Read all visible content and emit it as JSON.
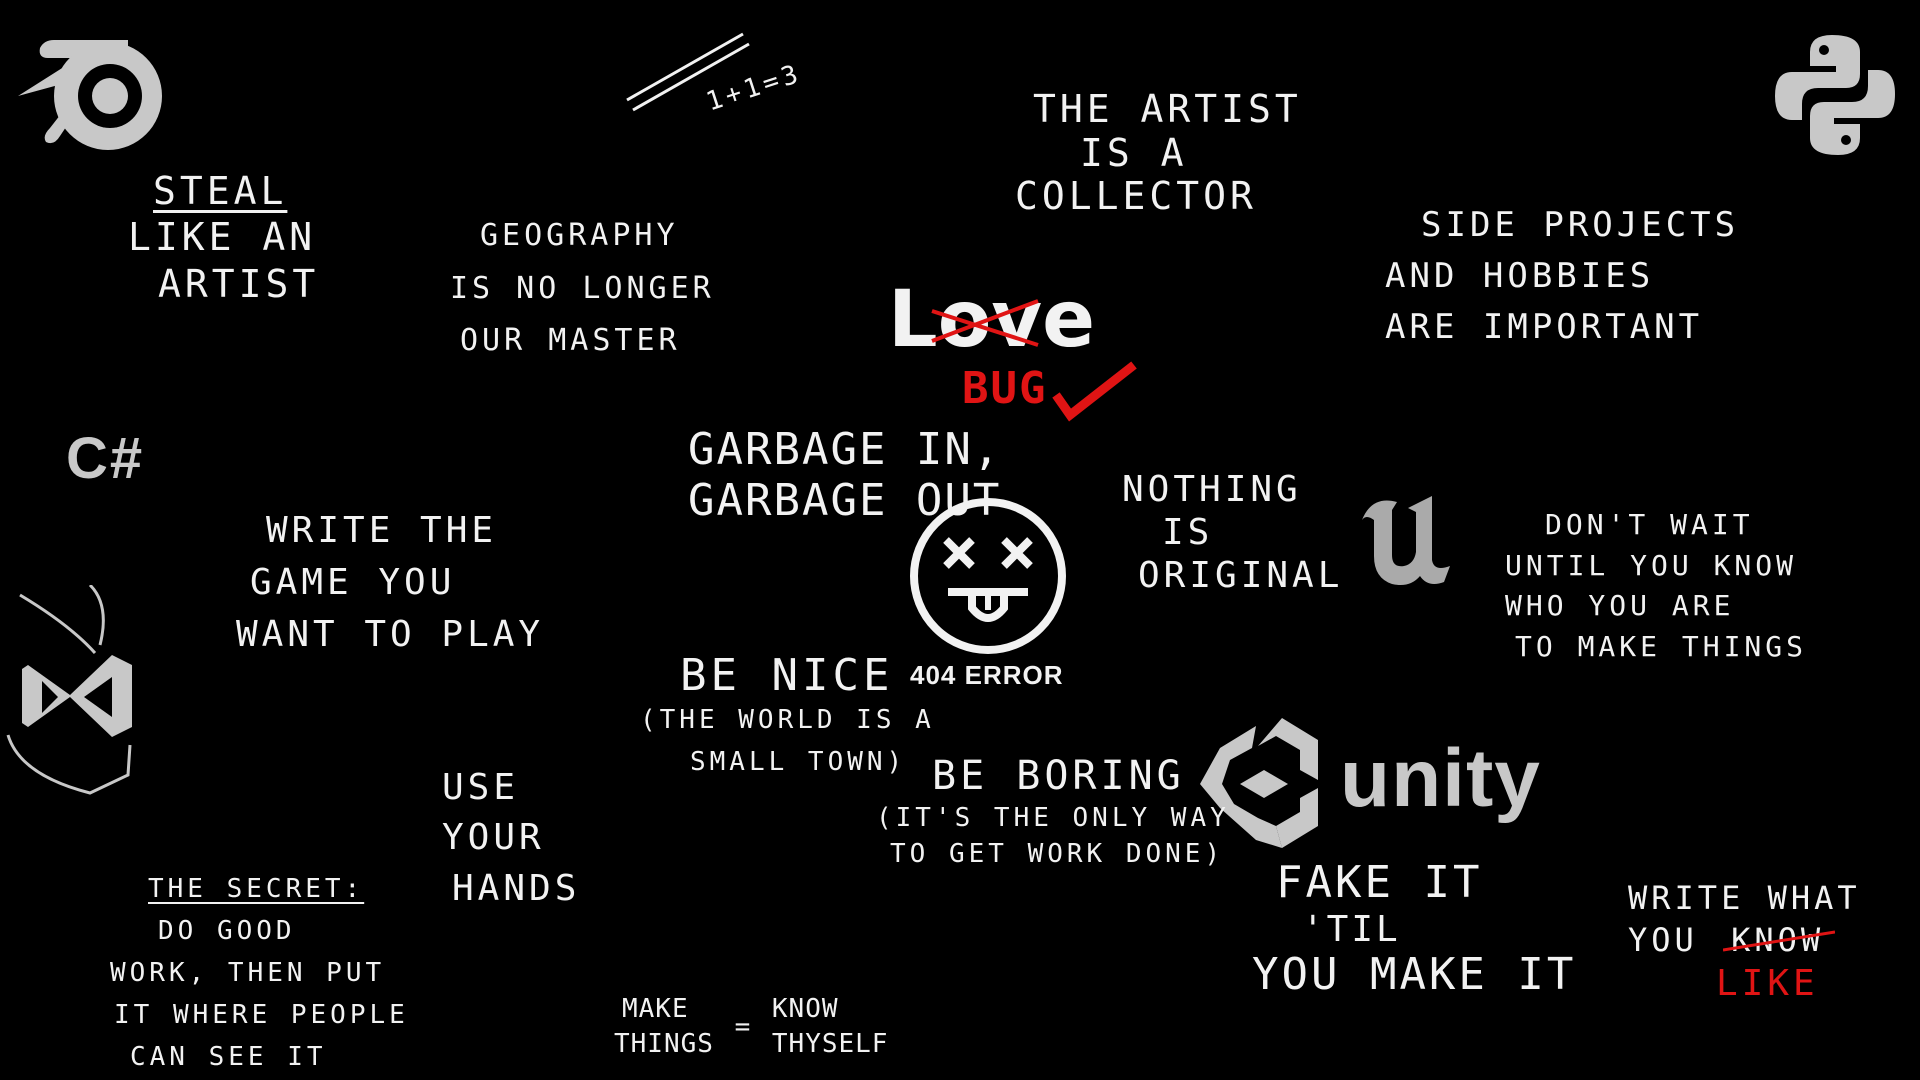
{
  "colors": {
    "background": "#000000",
    "text": "#f2f2f2",
    "accent_red": "#e01414",
    "logo_gray": "#c8c8c8"
  },
  "icons": {
    "blender": "blender-logo-icon",
    "python": "python-logo-icon",
    "csharp": "C#",
    "visual_studio": "visual-studio-logo-icon",
    "unreal": "unreal-engine-logo-icon",
    "unity": "unity",
    "sad_face": "dead-face-icon"
  },
  "quotes": {
    "math": "1+1=3",
    "steal": [
      "STEAL",
      "LIKE AN",
      "ARTIST"
    ],
    "geography": [
      "GEOGRAPHY",
      "IS NO LONGER",
      "OUR MASTER"
    ],
    "artist_collector": [
      "THE ARTIST",
      "IS A",
      "COLLECTOR"
    ],
    "side_projects": [
      "SIDE PROJECTS",
      "AND HOBBIES",
      "ARE IMPORTANT"
    ],
    "love": {
      "word": "Love",
      "crossed": "ov",
      "replacement": "BUG"
    },
    "garbage": [
      "GARBAGE IN,",
      "GARBAGE OUT"
    ],
    "error": "404 ERROR",
    "nothing_original": [
      "NOTHING",
      "IS",
      "ORIGINAL"
    ],
    "dont_wait": [
      "DON'T WAIT",
      "UNTIL YOU KNOW",
      "WHO YOU ARE",
      "TO MAKE THINGS"
    ],
    "write_game": [
      "WRITE THE",
      "GAME YOU",
      "WANT TO PLAY"
    ],
    "be_nice": [
      "BE NICE",
      "(THE WORLD IS A",
      "SMALL TOWN)"
    ],
    "be_boring": [
      "BE BORING",
      "(IT'S THE ONLY WAY",
      "TO GET WORK DONE)"
    ],
    "use_hands": [
      "USE",
      "YOUR",
      "HANDS"
    ],
    "secret": [
      "THE SECRET:",
      "DO GOOD",
      "WORK, THEN PUT",
      "IT WHERE PEOPLE",
      "CAN SEE IT"
    ],
    "make_things": {
      "left": [
        "MAKE",
        "THINGS"
      ],
      "equals": "=",
      "right": [
        "KNOW",
        "THYSELF"
      ]
    },
    "fake_it": [
      "FAKE IT",
      "'TIL",
      "YOU MAKE IT"
    ],
    "write_what": {
      "line1": "WRITE WHAT",
      "you": "YOU",
      "crossed": "KNOW",
      "replacement": "LIKE"
    }
  }
}
